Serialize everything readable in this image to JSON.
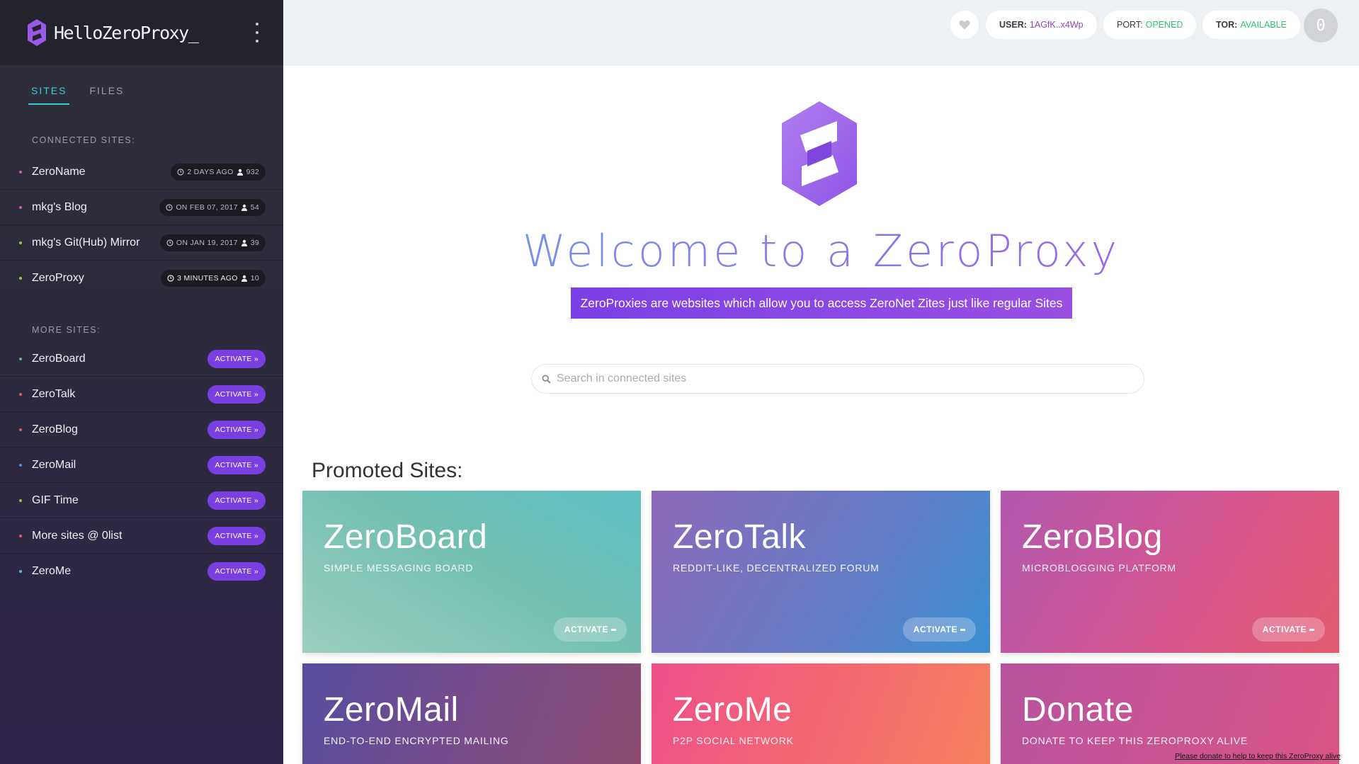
{
  "sidebar": {
    "brand": "HelloZeroProxy_",
    "tabs": [
      {
        "label": "SITES"
      },
      {
        "label": "FILES"
      }
    ],
    "connected_title": "CONNECTED SITES:",
    "connected": [
      {
        "name": "ZeroName",
        "meta": "2 DAYS AGO",
        "peers": "932",
        "dot": "#d85aa8"
      },
      {
        "name": "mkg's Blog",
        "meta": "ON FEB 07, 2017",
        "peers": "54",
        "dot": "#d85aa8"
      },
      {
        "name": "mkg's Git(Hub) Mirror",
        "meta": "ON JAN 19, 2017",
        "peers": "39",
        "dot": "#9cc44a"
      },
      {
        "name": "ZeroProxy",
        "meta": "3 MINUTES AGO",
        "peers": "10",
        "dot": "#9cc44a"
      }
    ],
    "more_title": "MORE SITES:",
    "activate_label": "ACTIVATE »",
    "more": [
      {
        "name": "ZeroBoard",
        "dot": "#5bbf7a"
      },
      {
        "name": "ZeroTalk",
        "dot": "#e0566b"
      },
      {
        "name": "ZeroBlog",
        "dot": "#e0566b"
      },
      {
        "name": "ZeroMail",
        "dot": "#4e8fe0"
      },
      {
        "name": "GIF Time",
        "dot": "#9cc44a"
      },
      {
        "name": "More sites @ 0list",
        "dot": "#e0566b"
      },
      {
        "name": "ZeroMe",
        "dot": "#4ec0d8"
      }
    ]
  },
  "topbar": {
    "user_key": "USER:",
    "user_value": "1AGfK..x4Wp",
    "port_key": "PORT:",
    "port_value": "OPENED",
    "tor_key": "TOR:",
    "tor_value": "AVAILABLE",
    "notifications": "0",
    "colors": {
      "user": "#8e44c7",
      "ok": "#2ec46b"
    }
  },
  "main": {
    "welcome": "Welcome to a ZeroProxy",
    "tagline": "ZeroProxies are websites which allow you to access ZeroNet Zites just like regular Sites",
    "search_placeholder": "Search in connected sites",
    "promoted_title": "Promoted Sites:",
    "card_button": "ACTIVATE",
    "cards": [
      {
        "title": "ZeroBoard",
        "subtitle": "SIMPLE MESSAGING BOARD"
      },
      {
        "title": "ZeroTalk",
        "subtitle": "REDDIT-LIKE, DECENTRALIZED FORUM"
      },
      {
        "title": "ZeroBlog",
        "subtitle": "MICROBLOGGING PLATFORM"
      },
      {
        "title": "ZeroMail",
        "subtitle": "END-TO-END ENCRYPTED MAILING"
      },
      {
        "title": "ZeroMe",
        "subtitle": "P2P SOCIAL NETWORK"
      },
      {
        "title": "Donate",
        "subtitle": "DONATE TO KEEP THIS ZEROPROXY ALIVE"
      }
    ],
    "donate_note": "Please donate to help to keep this ZeroProxy alive"
  }
}
